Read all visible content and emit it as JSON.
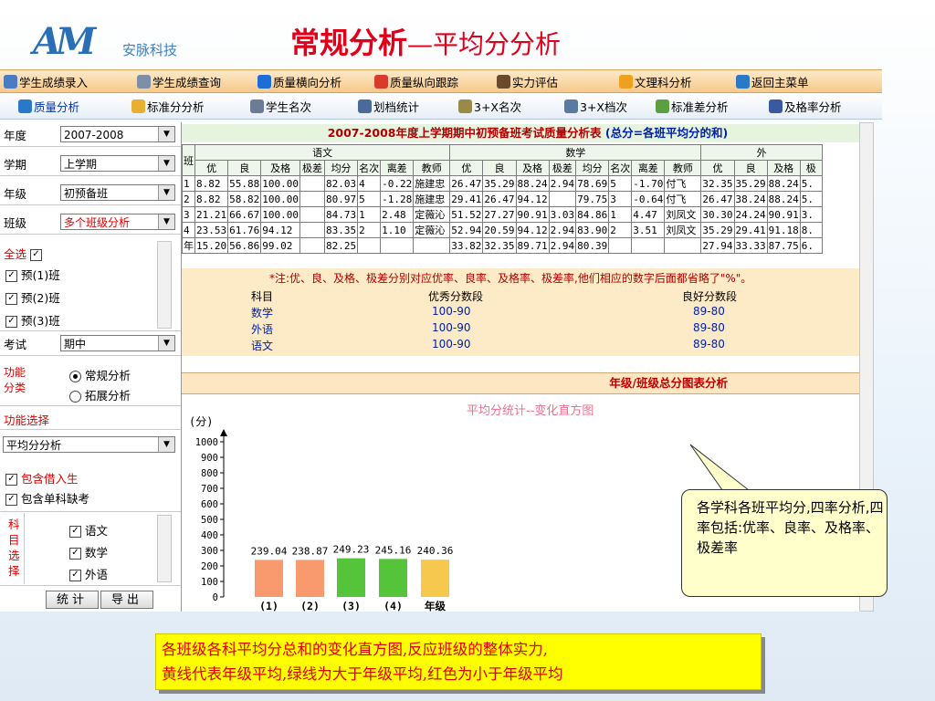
{
  "logo": {
    "mark": "AM",
    "cn": "安脉科技"
  },
  "title": {
    "main": "常规分析",
    "sub": "—平均分分析"
  },
  "menu1": [
    {
      "label": "学生成绩录入",
      "icon": "pencil-icon"
    },
    {
      "label": "学生成绩查询",
      "icon": "search-icon"
    },
    {
      "label": "质量横向分析",
      "icon": "bar-chart-icon"
    },
    {
      "label": "质量纵向跟踪",
      "icon": "pie-chart-icon"
    },
    {
      "label": "实力评估",
      "icon": "key-icon"
    },
    {
      "label": "文理科分析",
      "icon": "circle-icon"
    },
    {
      "label": "返回主菜单",
      "icon": "grid-icon"
    }
  ],
  "menu2": [
    {
      "label": "质量分析",
      "icon": "eye-icon"
    },
    {
      "label": "标准分分析",
      "icon": "lamp-icon"
    },
    {
      "label": "学生名次",
      "icon": "list-icon"
    },
    {
      "label": "划档统计",
      "icon": "tools-icon"
    },
    {
      "label": "3+X名次",
      "icon": "gear-icon"
    },
    {
      "label": "3+X档次",
      "icon": "calc-icon"
    },
    {
      "label": "标准差分析",
      "icon": "diamond-icon"
    },
    {
      "label": "及格率分析",
      "icon": "book-icon"
    }
  ],
  "filters": {
    "year": {
      "label": "年度",
      "value": "2007-2008"
    },
    "term": {
      "label": "学期",
      "value": "上学期"
    },
    "grade": {
      "label": "年级",
      "value": "初预备班"
    },
    "class": {
      "label": "班级",
      "value": "多个班级分析"
    },
    "select_all": "全选",
    "classes": [
      "预(1)班",
      "预(2)班",
      "预(3)班"
    ],
    "exam": {
      "label": "考试",
      "value": "期中"
    },
    "func_type": {
      "label": "功能分类",
      "options": [
        "常规分析",
        "拓展分析"
      ],
      "selected": 0
    },
    "func_select": {
      "label": "功能选择",
      "value": "平均分分析"
    },
    "opt_borrow": "包含借入生",
    "opt_missing": "包含单科缺考",
    "subject_label": "科目选择",
    "subjects": [
      "语文",
      "数学",
      "外语"
    ],
    "btn_stat": "统计",
    "btn_export": "导出"
  },
  "table": {
    "title": "2007-2008年度上学期期中初预备班考试质量分析表",
    "title_note": "(总分=各班平均分的和)",
    "class_header": "班",
    "subject_headers": [
      "语文",
      "数学",
      "外"
    ],
    "col_headers": [
      "优",
      "良",
      "及格",
      "极差",
      "均分",
      "名次",
      "离差",
      "教师",
      "优",
      "良",
      "及格",
      "极差",
      "均分",
      "名次",
      "离差",
      "教师",
      "优",
      "良",
      "及格",
      "极"
    ],
    "rows": [
      [
        "1",
        "8.82",
        "55.88",
        "100.00",
        "",
        "82.03",
        "4",
        "-0.22",
        "施建忠",
        "26.47",
        "35.29",
        "88.24",
        "2.94",
        "78.69",
        "5",
        "-1.70",
        "付飞",
        "32.35",
        "35.29",
        "88.24",
        "5."
      ],
      [
        "2",
        "8.82",
        "58.82",
        "100.00",
        "",
        "80.97",
        "5",
        "-1.28",
        "施建忠",
        "29.41",
        "26.47",
        "94.12",
        "",
        "79.75",
        "3",
        "-0.64",
        "付飞",
        "26.47",
        "38.24",
        "88.24",
        "5."
      ],
      [
        "3",
        "21.21",
        "66.67",
        "100.00",
        "",
        "84.73",
        "1",
        "2.48",
        "定薇沁",
        "51.52",
        "27.27",
        "90.91",
        "3.03",
        "84.86",
        "1",
        "4.47",
        "刘凤文",
        "30.30",
        "24.24",
        "90.91",
        "3."
      ],
      [
        "4",
        "23.53",
        "61.76",
        "94.12",
        "",
        "83.35",
        "2",
        "1.10",
        "定薇沁",
        "52.94",
        "20.59",
        "94.12",
        "2.94",
        "83.90",
        "2",
        "3.51",
        "刘凤文",
        "35.29",
        "29.41",
        "91.18",
        "8."
      ],
      [
        "年",
        "15.20",
        "56.86",
        "99.02",
        "",
        "82.25",
        "",
        "",
        "",
        "33.82",
        "32.35",
        "89.71",
        "2.94",
        "80.39",
        "",
        "",
        "",
        "27.94",
        "33.33",
        "87.75",
        "6."
      ]
    ]
  },
  "notes": {
    "star": "*注:优、良、及格、极差分别对应优率、良率、及格率、极差率,他们相应的数字后面都省略了\"%\"。",
    "headers": [
      "科目",
      "优秀分数段",
      "良好分数段"
    ],
    "rows": [
      [
        "数学",
        "100-90",
        "89-80"
      ],
      [
        "外语",
        "100-90",
        "89-80"
      ],
      [
        "语文",
        "100-90",
        "89-80"
      ]
    ]
  },
  "chart_section_title": "年级/班级总分图表分析",
  "chart_data": {
    "type": "bar",
    "title": "平均分统计--变化直方图",
    "ylabel": "(分)",
    "ylim": [
      0,
      1000
    ],
    "yticks": [
      0,
      100,
      200,
      300,
      400,
      500,
      600,
      700,
      800,
      900,
      1000
    ],
    "categories": [
      "(1)",
      "(2)",
      "(3)",
      "(4)",
      "年级"
    ],
    "values": [
      239.04,
      238.87,
      249.23,
      245.16,
      240.36
    ],
    "colors": [
      "#f89a6e",
      "#f89a6e",
      "#55c43a",
      "#55c43a",
      "#f6c84e"
    ]
  },
  "callout": "各学科各班平均分,四率分析,四率包括:优率、良率、及格率、极差率",
  "bottom_note": [
    "各班级各科平均分总和的变化直方图,反应班级的整体实力,",
    "黄线代表年级平均,绿线为大于年级平均,红色为小于年级平均"
  ]
}
